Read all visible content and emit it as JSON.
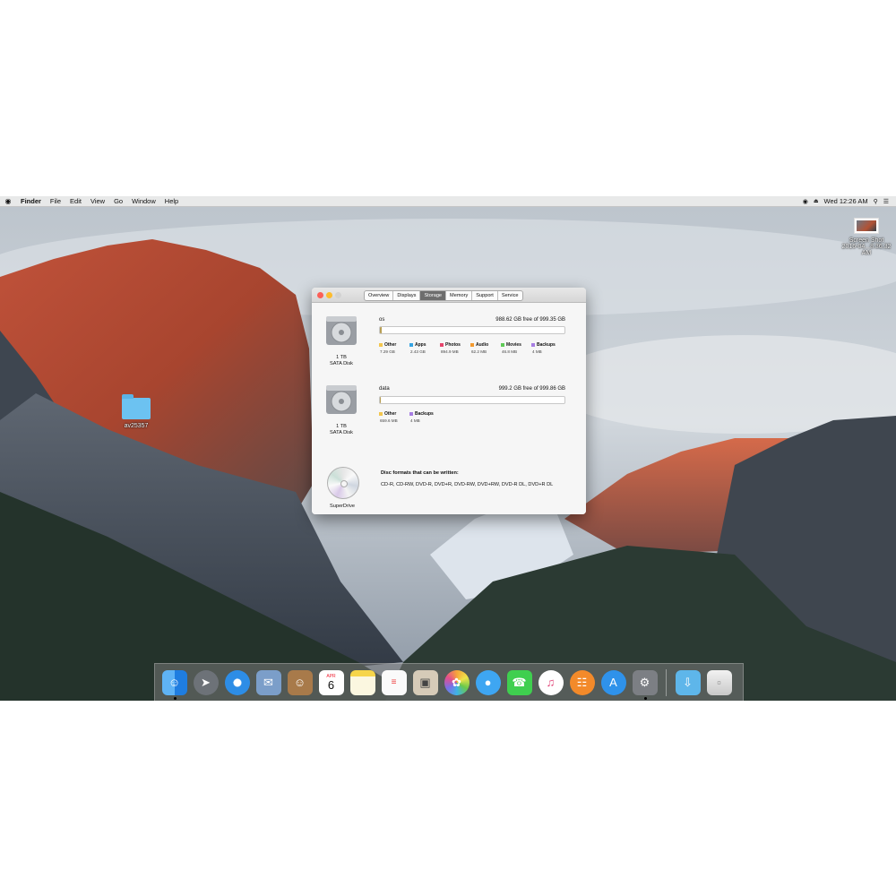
{
  "menubar": {
    "apple_icon": "",
    "app_name": "Finder",
    "menus": [
      "File",
      "Edit",
      "View",
      "Go",
      "Window",
      "Help"
    ],
    "clock": "Wed 12:26 AM"
  },
  "desktop": {
    "folder_label": "av25357",
    "screenshot_label_1": "Screen Shot",
    "screenshot_label_2": "2016-04...8.36.32 AM"
  },
  "window": {
    "tabs": [
      "Overview",
      "Displays",
      "Storage",
      "Memory",
      "Support",
      "Service"
    ],
    "active_tab": "Storage",
    "disks": [
      {
        "caption_1": "1 TB",
        "caption_2": "SATA Disk",
        "volume": "os",
        "free_text": "988.62 GB free of 999.35 GB",
        "used_fraction": 0.011,
        "legend": [
          {
            "label": "Other",
            "value": "7.29 GB",
            "color": "#f3c64e"
          },
          {
            "label": "Apps",
            "value": "2.43 GB",
            "color": "#36a4e3"
          },
          {
            "label": "Photos",
            "value": "894.9 MB",
            "color": "#e6456c"
          },
          {
            "label": "Audio",
            "value": "62.2 MB",
            "color": "#f39a2f"
          },
          {
            "label": "Movies",
            "value": "46.8 MB",
            "color": "#5fca57"
          },
          {
            "label": "Backups",
            "value": "4 MB",
            "color": "#a77ee3"
          }
        ]
      },
      {
        "caption_1": "1 TB",
        "caption_2": "SATA Disk",
        "volume": "data",
        "free_text": "999.2 GB free of 999.86 GB",
        "used_fraction": 0.0007,
        "legend": [
          {
            "label": "Other",
            "value": "659.6 MB",
            "color": "#f3c64e"
          },
          {
            "label": "Backups",
            "value": "4 MB",
            "color": "#a77ee3"
          }
        ]
      }
    ],
    "optical": {
      "caption": "SuperDrive",
      "formats_title": "Disc formats that can be written:",
      "formats": "CD-R, CD-RW, DVD-R, DVD+R, DVD-RW, DVD+RW, DVD-R DL, DVD+R DL"
    }
  },
  "dock": {
    "calendar_month": "APR",
    "calendar_day": "6"
  }
}
